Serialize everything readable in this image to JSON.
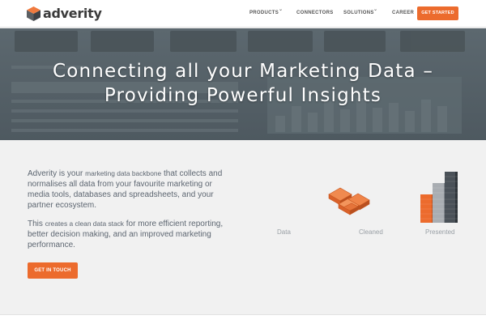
{
  "brand": {
    "name": "adverity",
    "accent": "#ec6b2d"
  },
  "nav": {
    "items": [
      {
        "label": "PRODUCTS",
        "dropdown": true
      },
      {
        "label": "CONNECTORS",
        "dropdown": false
      },
      {
        "label": "SOLUTIONS",
        "dropdown": true
      },
      {
        "label": "CAREER",
        "dropdown": false
      }
    ],
    "cta_label": "GET STARTED"
  },
  "hero": {
    "line1": "Connecting all your Marketing Data –",
    "line2": "Providing Powerful Insights"
  },
  "intro": {
    "p1_a": "Adverity is your",
    "p1_b": "marketing data backbone",
    "p1_c": "that collects and normalises all data from your favourite marketing or media tools, databases and spreadsheets, and your partner ecosystem.",
    "p2_a": "This",
    "p2_b": "creates a clean data stack",
    "p2_c": "for more efficient reporting, better decision making, and an improved marketing performance.",
    "cta_label": "GET IN TOUCH"
  },
  "illustrations": {
    "labels": [
      "Data",
      "Cleaned",
      "Presented"
    ],
    "icons": [
      "data-icon",
      "cleaned-blocks-icon",
      "presented-bars-icon"
    ]
  }
}
